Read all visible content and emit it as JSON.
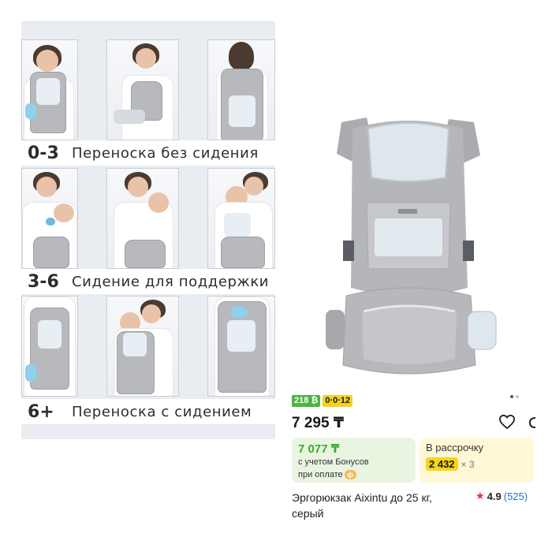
{
  "guide": {
    "rows": [
      {
        "age": "0-3",
        "description": "Переноска без сидения"
      },
      {
        "age": "3-6",
        "description": "Сидение для поддержки"
      },
      {
        "age": "6+",
        "description": "Переноска с сидением"
      }
    ]
  },
  "product": {
    "badges": {
      "bonus": "218 ₿",
      "installment": "0·0·12"
    },
    "price": "7 295 ₸",
    "bonus_offer": {
      "price": "7 077 ₸",
      "note_line1": "с учетом Бонусов",
      "note_line2": "при оплате"
    },
    "installment": {
      "title": "В рассрочку",
      "amount": "2 432",
      "times": "× 3"
    },
    "title": "Эргорюкзак Aixintu до 25 кг, серый",
    "rating": {
      "value": "4.9",
      "count": "(525)"
    },
    "image_dots": 2,
    "icons": [
      "heart-icon",
      "cart-icon",
      "star-icon",
      "payment-chip-icon"
    ]
  }
}
